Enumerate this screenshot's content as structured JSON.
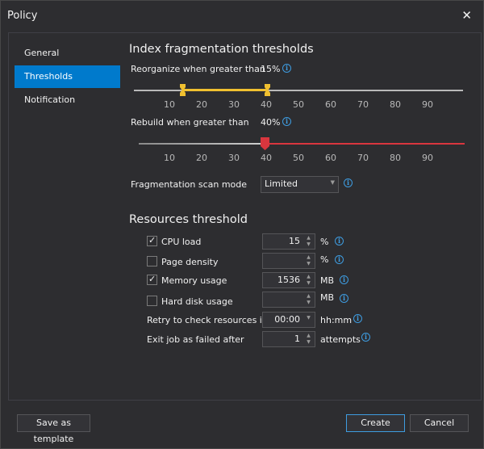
{
  "window": {
    "title": "Policy",
    "close_glyph": "✕"
  },
  "sidebar": {
    "items": [
      {
        "label": "General"
      },
      {
        "label": "Thresholds"
      },
      {
        "label": "Notification"
      }
    ],
    "selected": "Thresholds"
  },
  "fragmentation": {
    "heading": "Index fragmentation thresholds",
    "reorganize": {
      "label": "Reorganize when greater than",
      "value_text": "15%",
      "value": 15,
      "upper": 40
    },
    "rebuild": {
      "label": "Rebuild when greater than",
      "value_text": "40%",
      "value": 40
    },
    "ticks": [
      "10",
      "20",
      "30",
      "40",
      "50",
      "60",
      "70",
      "80",
      "90"
    ],
    "scan_mode": {
      "label": "Fragmentation scan mode",
      "value": "Limited"
    }
  },
  "resources": {
    "heading": "Resources threshold",
    "cpu": {
      "label": "CPU load",
      "checked": true,
      "value": "15",
      "unit": "%"
    },
    "page_density": {
      "label": "Page density",
      "checked": false,
      "value": "",
      "unit": "%"
    },
    "memory": {
      "label": "Memory usage",
      "checked": true,
      "value": "1536",
      "unit": "MB"
    },
    "disk": {
      "label": "Hard disk usage",
      "checked": false,
      "value": "",
      "unit": "MB"
    },
    "retry": {
      "label": "Retry to check resources in",
      "value": "00:00",
      "unit": "hh:mm"
    },
    "exit": {
      "label": "Exit job as failed after",
      "value": "1",
      "unit": "attempts"
    }
  },
  "buttons": {
    "save_template": "Save as template",
    "create": "Create",
    "cancel": "Cancel"
  },
  "colors": {
    "accent": "#007acc",
    "reorganize_range": "#f0c030",
    "rebuild_range": "#d9363e",
    "info": "#3e9ce0"
  },
  "icons": {
    "info": "info-icon",
    "check": "check-icon",
    "close": "close-icon",
    "spin_up": "chevron-up-icon",
    "spin_down": "chevron-down-icon",
    "dropdown": "chevron-down-icon"
  }
}
